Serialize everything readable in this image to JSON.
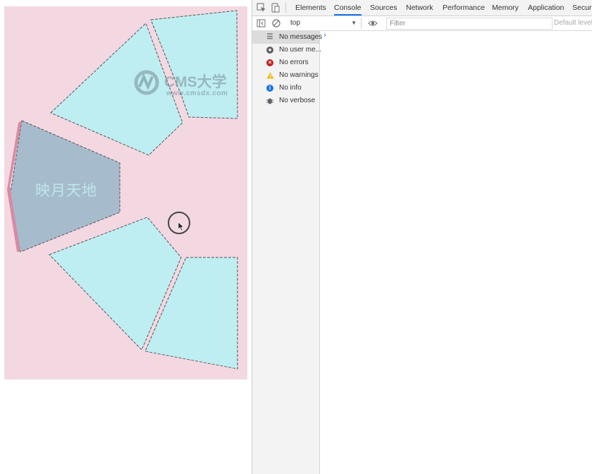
{
  "page": {
    "segment_label": "映月天地",
    "watermark": {
      "title": "CMS大学",
      "url": "www.cmsdx.com"
    }
  },
  "devtools": {
    "tabs": [
      {
        "label": "Elements",
        "active": false
      },
      {
        "label": "Console",
        "active": true
      },
      {
        "label": "Sources",
        "active": false
      },
      {
        "label": "Network",
        "active": false
      },
      {
        "label": "Performance",
        "active": false
      },
      {
        "label": "Memory",
        "active": false
      },
      {
        "label": "Application",
        "active": false
      },
      {
        "label": "Securit",
        "active": false
      }
    ],
    "context": "top",
    "filter_placeholder": "Filter",
    "levels": "Default levels",
    "sidebar": [
      {
        "label": "No messages",
        "icon": "list-icon",
        "selected": true
      },
      {
        "label": "No user me...",
        "icon": "user-icon",
        "selected": false
      },
      {
        "label": "No errors",
        "icon": "error-icon",
        "selected": false
      },
      {
        "label": "No warnings",
        "icon": "warning-icon",
        "selected": false
      },
      {
        "label": "No info",
        "icon": "info-icon",
        "selected": false
      },
      {
        "label": "No verbose",
        "icon": "bug-icon",
        "selected": false
      }
    ],
    "prompt": "›"
  },
  "colors": {
    "page_bg": "#f3d8e1",
    "segment_fill": "#bfeef2",
    "segment_active": "#a6bccd",
    "accent": "#1a73e8"
  }
}
